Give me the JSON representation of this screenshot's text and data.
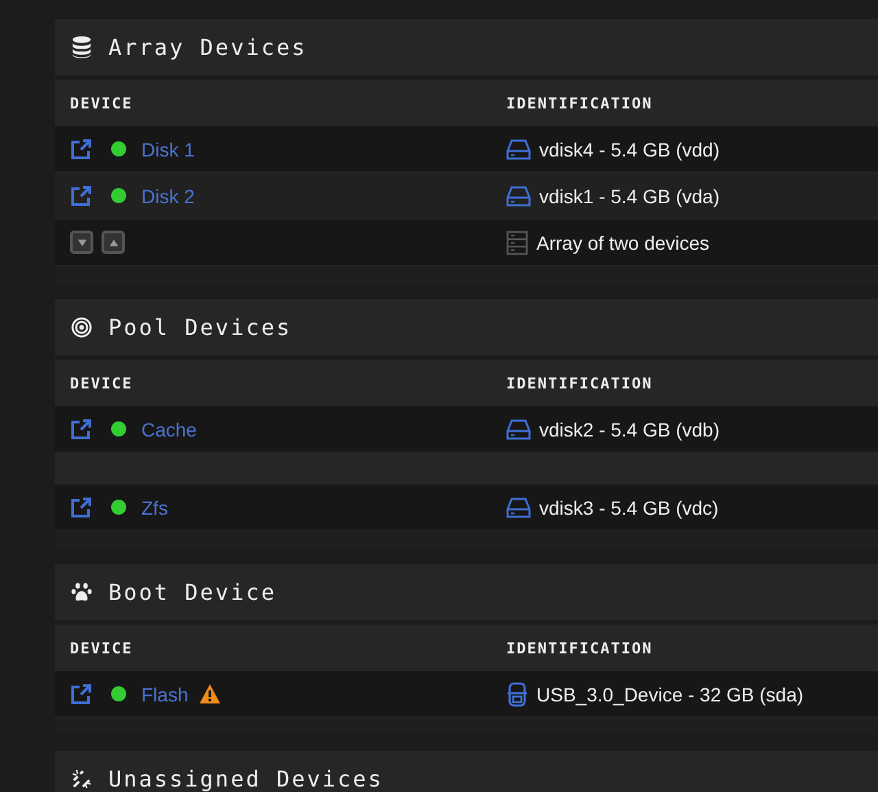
{
  "sections": [
    {
      "title": "Array Devices",
      "columns": [
        "DEVICE",
        "IDENTIFICATION"
      ],
      "rows": [
        {
          "kind": "device",
          "name": "Disk 1",
          "color": "#33cc33",
          "warning": false,
          "identification": "vdisk4 - 5.4 GB (vdd)"
        },
        {
          "kind": "device",
          "name": "Disk 2",
          "color": "#33cc33",
          "warning": false,
          "identification": "vdisk1 - 5.4 GB (vda)"
        },
        {
          "kind": "controls",
          "identification": "Array of two devices"
        }
      ]
    },
    {
      "title": "Pool Devices",
      "columns": [
        "DEVICE",
        "IDENTIFICATION"
      ],
      "rows": [
        {
          "kind": "device",
          "name": "Cache",
          "color": "#33cc33",
          "warning": false,
          "identification": "vdisk2 - 5.4 GB (vdb)"
        },
        {
          "kind": "spacer"
        },
        {
          "kind": "device",
          "name": "Zfs",
          "color": "#33cc33",
          "warning": false,
          "identification": "vdisk3 - 5.4 GB (vdc)"
        }
      ]
    },
    {
      "title": "Boot Device",
      "columns": [
        "DEVICE",
        "IDENTIFICATION"
      ],
      "rows": [
        {
          "kind": "device",
          "name": "Flash",
          "color": "#33cc33",
          "warning": true,
          "identification": "USB_3.0_Device - 32 GB (sda)"
        }
      ]
    },
    {
      "title": "Unassigned Devices"
    }
  ]
}
